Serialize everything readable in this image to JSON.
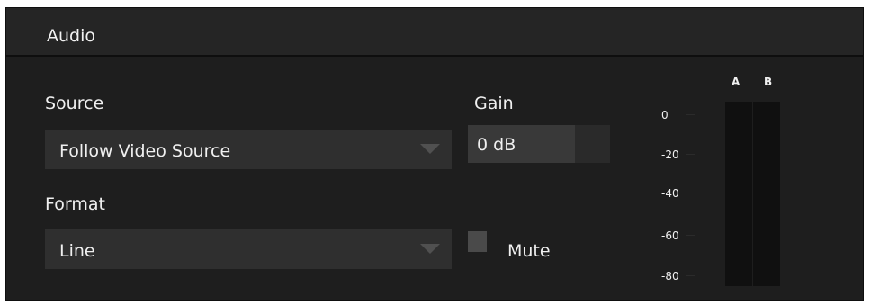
{
  "header": {
    "title": "Audio"
  },
  "source": {
    "label": "Source",
    "value": "Follow Video Source"
  },
  "format": {
    "label": "Format",
    "value": "Line"
  },
  "gain": {
    "label": "Gain",
    "value": "0 dB",
    "level_fraction": 0.75
  },
  "mute": {
    "label": "Mute",
    "checked": false
  },
  "meter": {
    "channels": [
      "A",
      "B"
    ],
    "scale": [
      "0",
      "-20",
      "-40",
      "-60",
      "-80"
    ]
  },
  "colors": {
    "panel": "#1e1e1e",
    "accent": "#1b74c9"
  }
}
